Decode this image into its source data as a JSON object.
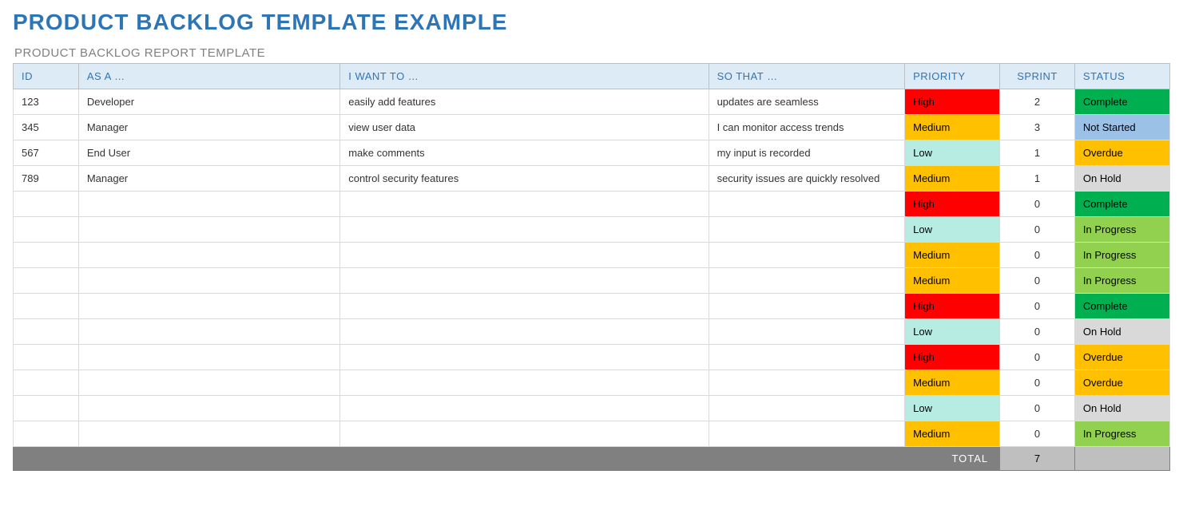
{
  "title": "PRODUCT BACKLOG TEMPLATE EXAMPLE",
  "section": "PRODUCT BACKLOG REPORT TEMPLATE",
  "columns": {
    "id": "ID",
    "asa": "AS A …",
    "want": "I WANT TO …",
    "so": "SO THAT …",
    "priority": "PRIORITY",
    "sprint": "SPRINT",
    "status": "STATUS"
  },
  "rows": [
    {
      "id": "123",
      "asa": "Developer",
      "want": "easily add features",
      "so": "updates are seamless",
      "priority": "High",
      "sprint": "2",
      "status": "Complete"
    },
    {
      "id": "345",
      "asa": "Manager",
      "want": "view user data",
      "so": "I can monitor access trends",
      "priority": "Medium",
      "sprint": "3",
      "status": "Not Started"
    },
    {
      "id": "567",
      "asa": "End User",
      "want": "make comments",
      "so": "my input is recorded",
      "priority": "Low",
      "sprint": "1",
      "status": "Overdue"
    },
    {
      "id": "789",
      "asa": "Manager",
      "want": "control security features",
      "so": "security issues are quickly resolved",
      "priority": "Medium",
      "sprint": "1",
      "status": "On Hold"
    },
    {
      "id": "",
      "asa": "",
      "want": "",
      "so": "",
      "priority": "High",
      "sprint": "0",
      "status": "Complete"
    },
    {
      "id": "",
      "asa": "",
      "want": "",
      "so": "",
      "priority": "Low",
      "sprint": "0",
      "status": "In Progress"
    },
    {
      "id": "",
      "asa": "",
      "want": "",
      "so": "",
      "priority": "Medium",
      "sprint": "0",
      "status": "In Progress"
    },
    {
      "id": "",
      "asa": "",
      "want": "",
      "so": "",
      "priority": "Medium",
      "sprint": "0",
      "status": "In Progress"
    },
    {
      "id": "",
      "asa": "",
      "want": "",
      "so": "",
      "priority": "High",
      "sprint": "0",
      "status": "Complete"
    },
    {
      "id": "",
      "asa": "",
      "want": "",
      "so": "",
      "priority": "Low",
      "sprint": "0",
      "status": "On Hold"
    },
    {
      "id": "",
      "asa": "",
      "want": "",
      "so": "",
      "priority": "High",
      "sprint": "0",
      "status": "Overdue"
    },
    {
      "id": "",
      "asa": "",
      "want": "",
      "so": "",
      "priority": "Medium",
      "sprint": "0",
      "status": "Overdue"
    },
    {
      "id": "",
      "asa": "",
      "want": "",
      "so": "",
      "priority": "Low",
      "sprint": "0",
      "status": "On Hold"
    },
    {
      "id": "",
      "asa": "",
      "want": "",
      "so": "",
      "priority": "Medium",
      "sprint": "0",
      "status": "In Progress"
    }
  ],
  "total": {
    "label": "TOTAL",
    "value": "7"
  }
}
